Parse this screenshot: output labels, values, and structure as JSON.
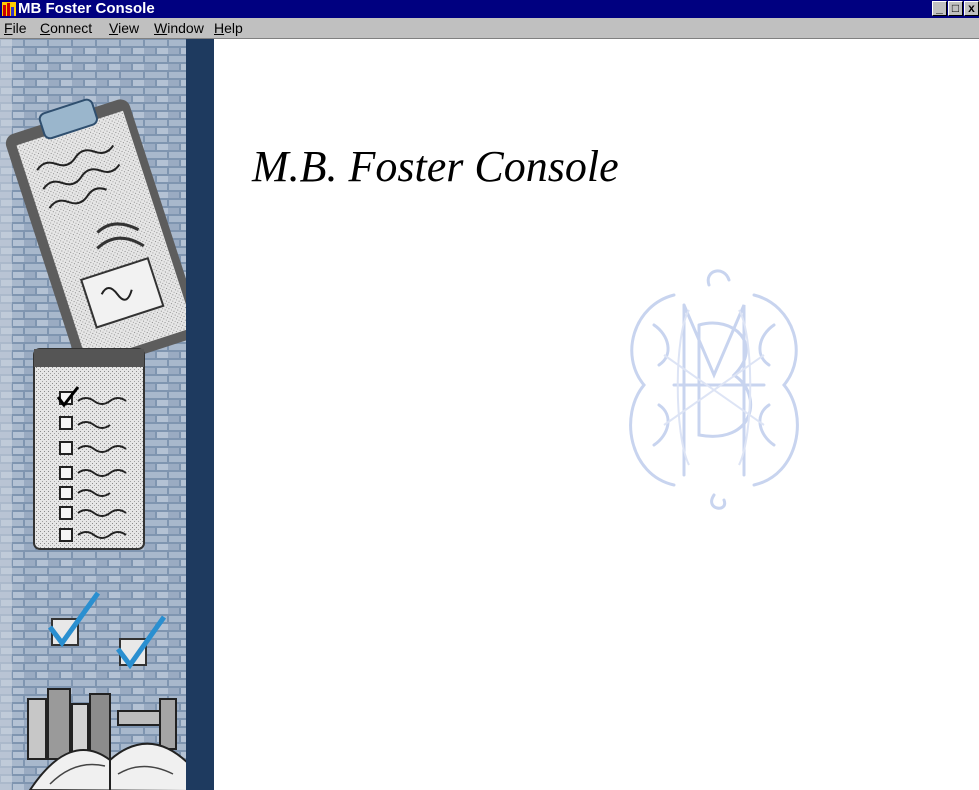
{
  "window": {
    "title": "MB Foster  Console",
    "controls": {
      "minimize": "_",
      "maximize": "□",
      "close": "x"
    }
  },
  "menu": [
    {
      "key": "F",
      "rest": "ile"
    },
    {
      "key": "C",
      "rest": "onnect"
    },
    {
      "key": "V",
      "rest": "iew"
    },
    {
      "key": "W",
      "rest": "indow"
    },
    {
      "key": "H",
      "rest": "elp"
    }
  ],
  "main": {
    "heading": "M.B. Foster Console"
  },
  "icons": {
    "app": "app-icon",
    "sidebar": "clipboard-checklist-illustration",
    "watermark": "mbf-monogram-logo"
  },
  "colors": {
    "titlebar": "#000080",
    "menubar": "#c0c0c0",
    "sidebar_stripe": "#1e3a5f",
    "watermark": "#c8d4ef"
  }
}
